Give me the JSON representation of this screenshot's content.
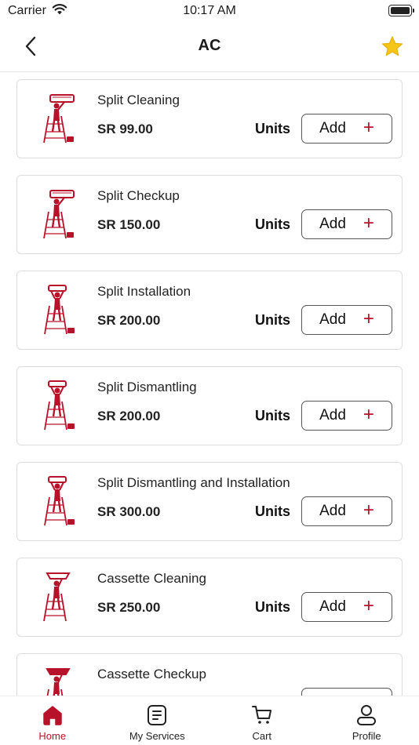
{
  "status_bar": {
    "carrier": "Carrier",
    "time": "10:17 AM"
  },
  "nav": {
    "title": "AC"
  },
  "services": [
    {
      "name": "Split Cleaning",
      "price": "SR 99.00",
      "units_label": "Units",
      "add_label": "Add"
    },
    {
      "name": "Split Checkup",
      "price": "SR 150.00",
      "units_label": "Units",
      "add_label": "Add"
    },
    {
      "name": "Split Installation",
      "price": "SR 200.00",
      "units_label": "Units",
      "add_label": "Add"
    },
    {
      "name": "Split Dismantling",
      "price": "SR 200.00",
      "units_label": "Units",
      "add_label": "Add"
    },
    {
      "name": "Split Dismantling and Installation",
      "price": "SR 300.00",
      "units_label": "Units",
      "add_label": "Add"
    },
    {
      "name": "Cassette Cleaning",
      "price": "SR 250.00",
      "units_label": "Units",
      "add_label": "Add"
    },
    {
      "name": "Cassette Checkup",
      "price": "",
      "units_label": "",
      "add_label": ""
    }
  ],
  "tabs": [
    {
      "label": "Home",
      "icon": "home-icon",
      "active": true
    },
    {
      "label": "My Services",
      "icon": "services-icon",
      "active": false
    },
    {
      "label": "Cart",
      "icon": "cart-icon",
      "active": false
    },
    {
      "label": "Profile",
      "icon": "profile-icon",
      "active": false
    }
  ],
  "colors": {
    "accent": "#b7122a",
    "star": "#f5c518",
    "border": "#dcdcdc"
  }
}
